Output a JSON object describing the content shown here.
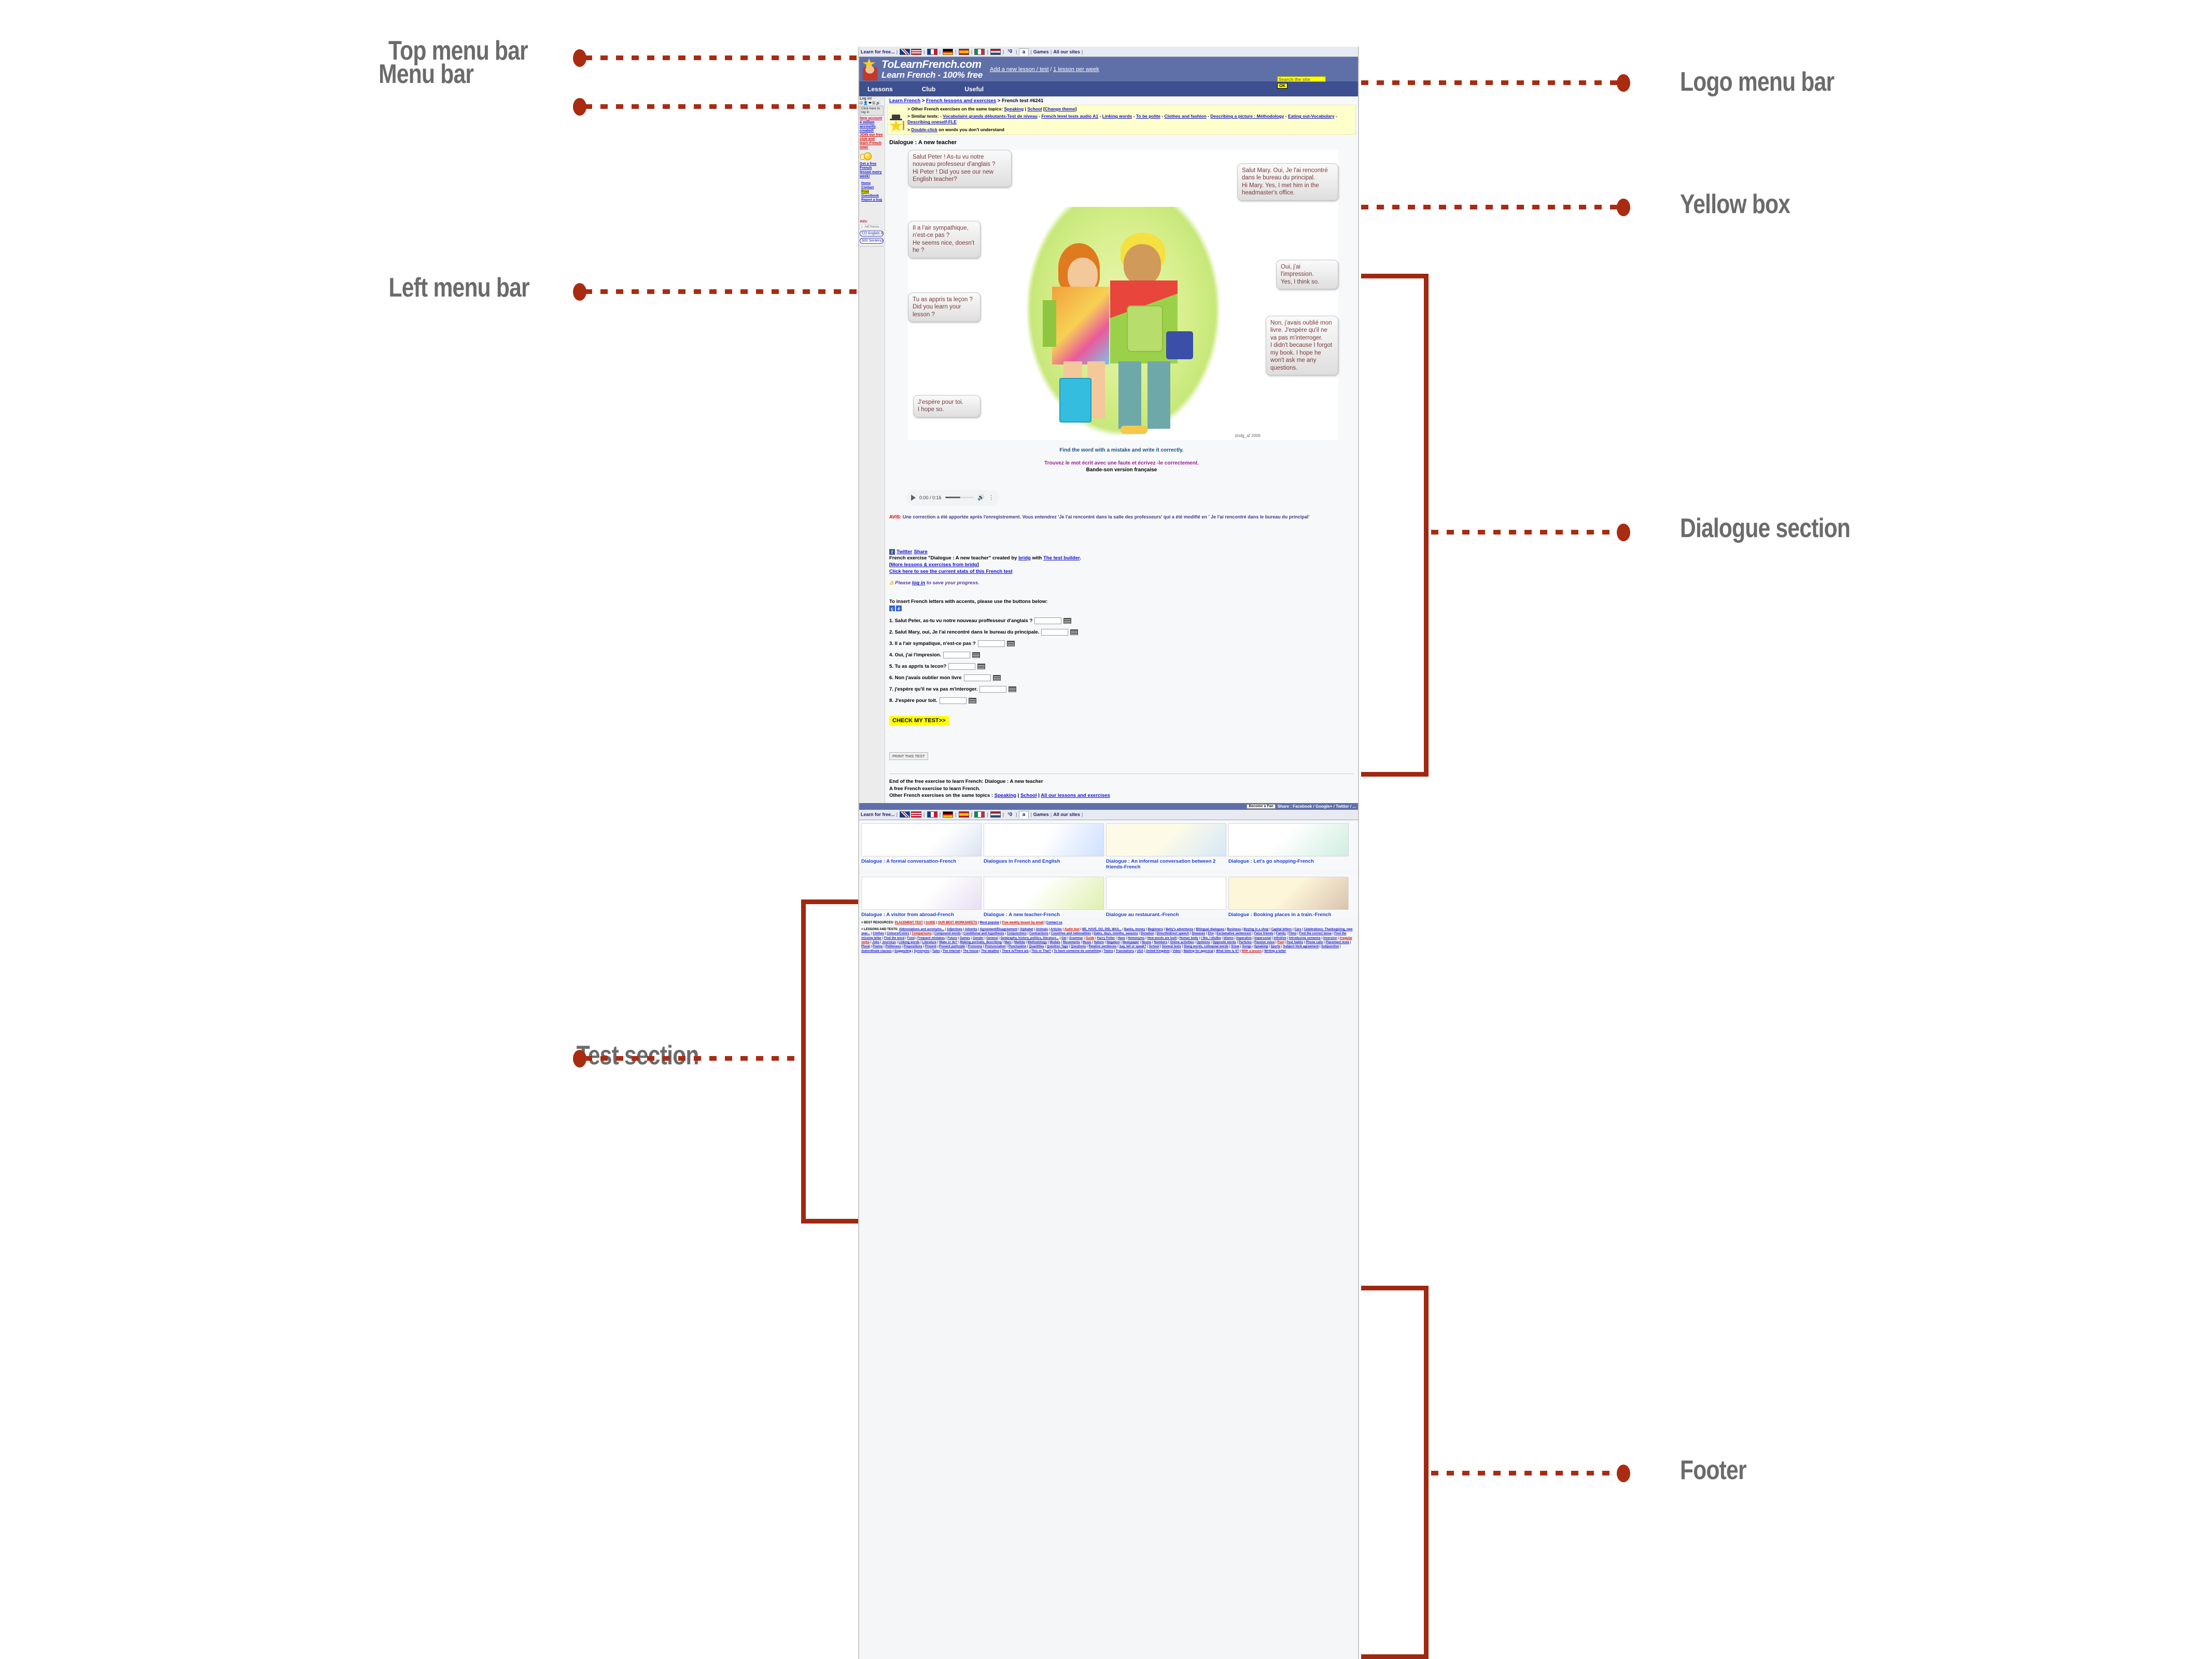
{
  "annotations": {
    "left": [
      {
        "label": "Top menu bar"
      },
      {
        "label": "Menu bar"
      },
      {
        "label": "Left menu bar"
      },
      {
        "label": "Test section"
      }
    ],
    "right": [
      {
        "label": "Logo menu bar"
      },
      {
        "label": "Yellow box"
      },
      {
        "label": "Dialogue section"
      },
      {
        "label": "Footer"
      }
    ],
    "accent_color": "#a02810",
    "label_color": "#6b6b6b"
  },
  "topbar": {
    "learn_for_free": "Learn for free...",
    "flags": [
      "uk-us-flag-icon",
      "france-flag-icon",
      "germany-flag-icon",
      "spain-flag-icon",
      "italy-flag-icon",
      "netherlands-flag-icon"
    ],
    "tab_io": "¹0",
    "tab_a": "a",
    "games": "Games",
    "all_our_sites": "All our sites"
  },
  "logobar": {
    "brand_line1": "ToLearnFrench.com",
    "brand_line2": "Learn French - 100% free",
    "link_add_lesson": "Add a new lesson / test",
    "separator": "/",
    "link_weekly": "1 lesson per week"
  },
  "navbar": {
    "items": [
      "Lessons",
      "Club",
      "Useful"
    ],
    "search_placeholder": "Search the site",
    "search_button": "OK"
  },
  "sidebar": {
    "login_title": "Log in!",
    "icons": [
      "checkbox-icon",
      "user-icon",
      "heart-icon",
      "list-icon",
      "speaker-icon",
      "note-icon",
      "close-icon"
    ],
    "click_here_btn": "Click here to log in",
    "links": [
      {
        "label": "New account",
        "color": "pink"
      },
      {
        "label": "4 million accounts created!",
        "color": "blue"
      },
      {
        "label": "JOIN our free club and learn French now!",
        "color": "red"
      }
    ],
    "promo": "Get a free French lesson every week!",
    "submenu": [
      "Home",
      "Contact",
      "Print",
      "Guestbook",
      "Report a bug"
    ],
    "submenu_highlight": "Print",
    "ads_label": "Ads:",
    "adchoices": "AdChoices",
    "ad_items": [
      "CD Anglais 4EME",
      "600 Sentences"
    ]
  },
  "breadcrumb": {
    "home": "Learn French",
    "sep": ">",
    "lessons": "French lessons and exercises",
    "current": "French test #6241"
  },
  "yellowbox": {
    "line1_prefix": "> Other French exercises on the same topics:",
    "topic1": "Speaking",
    "topic_sep": "|",
    "topic2": "School",
    "change_theme_open": "[",
    "change_theme": "Change theme",
    "change_theme_close": "]",
    "line2_prefix": "> Similar tests: -",
    "similar_tests": [
      "Vocabulaire grands débutants-Test de niveau",
      "French level tests audio A1",
      "Linking words",
      "To be polite",
      "Clothes and fashion",
      "Describing a picture : Méthodology",
      "Eating out-Vocabulary",
      "Describing oneself-FLE"
    ],
    "line3_prefix": ">",
    "doubleclick_link": "Double-click",
    "line3_suffix": "on words you don't understand"
  },
  "exercise": {
    "title": "Dialogue : A new teacher",
    "image_credit": "bridg_af 2006",
    "bubbles": [
      {
        "id": "b1",
        "fr": "Salut Peter !  As-tu vu notre nouveau professeur d'anglais ?",
        "en": "Hi Peter ! Did you see our new English teacher?"
      },
      {
        "id": "b2",
        "fr": "Salut Mary. Oui, Je l'ai rencontré dans le bureau du principal.",
        "en": "Hi Mary. Yes, I met him in the headmaster's office."
      },
      {
        "id": "b3",
        "fr": "Il a l'air sympathique, n'est-ce pas ?",
        "en": "He seems nice, doesn't he ?"
      },
      {
        "id": "b4",
        "fr": "Oui, j'ai l'impression.",
        "en": "Yes, I think so."
      },
      {
        "id": "b5",
        "fr": " Tu as appris ta leçon ?",
        "en": "Did you learn your lesson ?"
      },
      {
        "id": "b6",
        "fr": "Non, j'avais oublié mon livre. J'espère qu'il ne va pas m'interroger.",
        "en": "I didn't because I forgot my book. I hope he won't ask me any questions."
      },
      {
        "id": "b7",
        "fr": "J'espère pour toi.",
        "en": "I hope so."
      }
    ],
    "instruction_en": "Find the word with a mistake and write it correctly.",
    "instruction_fr": "Trouvez le mot écrit avec une faute et écrivez -le correctement.",
    "audio_label": "Bande-son version française",
    "player": {
      "time": "0:00 / 0:16",
      "play_icon": "play-icon",
      "volume_icon": "volume-icon",
      "menu_icon": "kebab-menu-icon"
    },
    "avis_label": "AVIS:",
    "avis_text": " Une correction a été apportée après l'enregistrement. Vous entendrez 'Je l'ai rencontré dans la salle des professeurs' qui a été modifié en ' Je l'ai rencontré dans le bureau du principal'"
  },
  "share": {
    "facebook_icon": "facebook-icon",
    "twitter": "Twitter",
    "share": "Share",
    "credit_pre": "French exercise \"Dialogue : A new teacher\" created by ",
    "author": "bridg",
    "credit_mid": " with ",
    "builder": "The test builder",
    "credit_post": ".",
    "more_open": "[",
    "more": "More lessons & exercises from bridg",
    "more_close": "]",
    "stats_link": "Click here to see the current stats of this French test",
    "login_pre": "Please ",
    "login_link": "log in",
    "login_post": " to save your progress."
  },
  "accents": {
    "label": "To insert French letters with accents, please use the buttons below:",
    "buttons": [
      "ç",
      "é"
    ]
  },
  "questions": [
    {
      "n": "1.",
      "text": "Salut Peter, as-tu vu notre nouveau proffesseur d'anglais ?",
      "value": ""
    },
    {
      "n": "2.",
      "text": "Salut Mary, oui, Je l'ai rencontré dans le bureau du principale.",
      "value": ""
    },
    {
      "n": "3.",
      "text": "Il a l'air sympatique, n'est-ce pas ?",
      "value": ""
    },
    {
      "n": "4.",
      "text": "Oui, j'ai l'impresion.",
      "value": ""
    },
    {
      "n": "5.",
      "text": "Tu as appris ta lecon?",
      "value": ""
    },
    {
      "n": "6.",
      "text": "Non j'avais oublier mon livre",
      "value": ""
    },
    {
      "n": "7.",
      "text": "j'espère qu'il ne va pas m'interoger.",
      "value": ""
    },
    {
      "n": "8.",
      "text": "J'espère pour toit.",
      "value": ""
    }
  ],
  "actions": {
    "check": "CHECK MY TEST>>",
    "print": "PRINT THIS TEST"
  },
  "end": {
    "line1": "End of the free exercise to learn French: Dialogue : A new teacher",
    "line2": "A free French exercise to learn French.",
    "line3_prefix": "Other French exercises on the same topics : ",
    "topic1": "Speaking",
    "sep": " | ",
    "topic2": "School",
    "topic3": "All our lessons and exercises"
  },
  "footer": {
    "become_fan": "Become a Fan",
    "share_text": "Share : Facebook / Google+ / Twitter / ...",
    "thumbs_row1": [
      {
        "caption": "Dialogue : A formal conversation-French"
      },
      {
        "caption": "Dialogues in French and English"
      },
      {
        "caption": "Dialogue : An informal conversation between 2 friends-French"
      },
      {
        "caption": "Dialogue : Let's go shopping-French"
      }
    ],
    "thumbs_row2": [
      {
        "caption": "Dialogue : A visitor from abroad-French"
      },
      {
        "caption": "Dialogue : A new teacher-French"
      },
      {
        "caption": "Dialogue au restaurant.-French"
      },
      {
        "caption": "Dialogue : Booking places in a train.-French"
      }
    ],
    "best_resources_label": "> BEST RESOURCES:",
    "best_resources": [
      {
        "label": "PLACEMENT TEST",
        "red": true
      },
      {
        "label": "GUIDE",
        "red": true
      },
      {
        "label": "OUR BEST WORKSHEETS",
        "red": true
      },
      {
        "label": "Most popular",
        "red": false
      },
      {
        "label": "Free weekly lesson by email",
        "red": true
      },
      {
        "label": "Contact us",
        "red": false
      }
    ],
    "lessons_label": "> LESSONS AND TESTS:",
    "lessons_links": [
      {
        "label": "Abbreviations and acronyms...",
        "red": false
      },
      {
        "label": "Adjectives",
        "red": false
      },
      {
        "label": "Adverbs",
        "red": false
      },
      {
        "label": "Agreement/Disagreement",
        "red": false
      },
      {
        "label": "Alphabet",
        "red": false
      },
      {
        "label": "Animals",
        "red": false
      },
      {
        "label": "Articles",
        "red": false
      },
      {
        "label": "Audio test",
        "red": true
      },
      {
        "label": "BE, HAVE, DO, DID, WAS...",
        "red": false
      },
      {
        "label": "Banks, money",
        "red": false
      },
      {
        "label": "Beginners",
        "red": false
      },
      {
        "label": "Betty's adventures",
        "red": false
      },
      {
        "label": "Bilingual dialogues",
        "red": false
      },
      {
        "label": "Business",
        "red": false
      },
      {
        "label": "Buying in a shop",
        "red": false
      },
      {
        "label": "Capital letters",
        "red": false
      },
      {
        "label": "Cars",
        "red": false
      },
      {
        "label": "Celebrations: Thanksgiving, new year...",
        "red": false
      },
      {
        "label": "Clothes",
        "red": false
      },
      {
        "label": "Colours/Colors",
        "red": false
      },
      {
        "label": "Comparisons",
        "red": true
      },
      {
        "label": "Compound words",
        "red": false
      },
      {
        "label": "Conditional and hypothesis",
        "red": false
      },
      {
        "label": "Conjunctions",
        "red": false
      },
      {
        "label": "Contractions",
        "red": false
      },
      {
        "label": "Countries and nationalities",
        "red": false
      },
      {
        "label": "Dates, days, months, seasons",
        "red": false
      },
      {
        "label": "Dictation",
        "red": false
      },
      {
        "label": "Direct/Indirect speech",
        "red": false
      },
      {
        "label": "Diseases",
        "red": false
      },
      {
        "label": "Etre",
        "red": false
      },
      {
        "label": "Exclamative sentences!",
        "red": false
      },
      {
        "label": "False friends",
        "red": false
      },
      {
        "label": "Family",
        "red": false
      },
      {
        "label": "Films",
        "red": false
      },
      {
        "label": "Find the correct tense",
        "red": false
      },
      {
        "label": "Find the missing letter",
        "red": false
      },
      {
        "label": "Find the word",
        "red": false
      },
      {
        "label": "Food",
        "red": false
      },
      {
        "label": "Frequent mistakes",
        "red": false
      },
      {
        "label": "Future",
        "red": false
      },
      {
        "label": "Games",
        "red": false
      },
      {
        "label": "Gender",
        "red": false
      },
      {
        "label": "General",
        "red": false
      },
      {
        "label": "Geography, history, politics, literature...",
        "red": false
      },
      {
        "label": "Get",
        "red": false
      },
      {
        "label": "Grammar",
        "red": false
      },
      {
        "label": "Guide",
        "red": true
      },
      {
        "label": "Harry Potter",
        "red": false
      },
      {
        "label": "Have",
        "red": false
      },
      {
        "label": "Homonyms",
        "red": false
      },
      {
        "label": "How words are built",
        "red": false
      },
      {
        "label": "Human body",
        "red": false
      },
      {
        "label": "I like, I dislike",
        "red": false
      },
      {
        "label": "Idioms",
        "red": false
      },
      {
        "label": "Imperative",
        "red": false
      },
      {
        "label": "Impersonal",
        "red": false
      },
      {
        "label": "Infinitive",
        "red": false
      },
      {
        "label": "Introducing someone",
        "red": false
      },
      {
        "label": "Inversion",
        "red": false
      },
      {
        "label": "Irregular verbs",
        "red": true
      },
      {
        "label": "Jobs",
        "red": false
      },
      {
        "label": "Journeys",
        "red": false
      },
      {
        "label": "Linking words",
        "red": false
      },
      {
        "label": "Literature",
        "red": false
      },
      {
        "label": "Make or do?",
        "red": false
      },
      {
        "label": "Making portraits, describing",
        "red": false
      },
      {
        "label": "Mars",
        "red": false
      },
      {
        "label": "Matilda",
        "red": false
      },
      {
        "label": "Methodology",
        "red": false
      },
      {
        "label": "Modals",
        "red": false
      },
      {
        "label": "Movements",
        "red": false
      },
      {
        "label": "Music",
        "red": false
      },
      {
        "label": "Nature",
        "red": false
      },
      {
        "label": "Negation",
        "red": false
      },
      {
        "label": "Newspaper",
        "red": false
      },
      {
        "label": "Nouns",
        "red": false
      },
      {
        "label": "Numbers",
        "red": false
      },
      {
        "label": "Online activities",
        "red": false
      },
      {
        "label": "Opinions",
        "red": false
      },
      {
        "label": "Opposite words",
        "red": false
      },
      {
        "label": "Particles",
        "red": false
      },
      {
        "label": "Passive voice",
        "red": false
      },
      {
        "label": "Past",
        "red": true
      },
      {
        "label": "Past habits",
        "red": false
      },
      {
        "label": "Phone calls",
        "red": false
      },
      {
        "label": "Placement tests",
        "red": false
      },
      {
        "label": "Plural",
        "red": false
      },
      {
        "label": "Poems",
        "red": false
      },
      {
        "label": "Politeness",
        "red": false
      },
      {
        "label": "Prepositions",
        "red": false
      },
      {
        "label": "Present",
        "red": false
      },
      {
        "label": "Present participle",
        "red": false
      },
      {
        "label": "Pronouns",
        "red": false
      },
      {
        "label": "Pronunciation",
        "red": false
      },
      {
        "label": "Punctuation",
        "red": false
      },
      {
        "label": "Quantities",
        "red": false
      },
      {
        "label": "Question Tags",
        "red": false
      },
      {
        "label": "Questions",
        "red": false
      },
      {
        "label": "Relative sentences",
        "red": false
      },
      {
        "label": "Say, tell or speak?",
        "red": false
      },
      {
        "label": "School",
        "red": false
      },
      {
        "label": "Several tests",
        "red": false
      },
      {
        "label": "Slang words, colloquial words",
        "red": false
      },
      {
        "label": "Snow",
        "red": false
      },
      {
        "label": "Songs",
        "red": false
      },
      {
        "label": "Speaking",
        "red": false
      },
      {
        "label": "Sports",
        "red": false
      },
      {
        "label": "Subject-Verb agreement",
        "red": false
      },
      {
        "label": "Subjunctive",
        "red": false
      },
      {
        "label": "Subordinate clauses",
        "red": false
      },
      {
        "label": "Suggesting",
        "red": false
      },
      {
        "label": "Synonyms",
        "red": false
      },
      {
        "label": "Tales",
        "red": false
      },
      {
        "label": "The Internet",
        "red": false
      },
      {
        "label": "The house",
        "red": false
      },
      {
        "label": "The weather",
        "red": false
      },
      {
        "label": "There is/There are",
        "red": false
      },
      {
        "label": "This or That?",
        "red": false
      },
      {
        "label": "To have someone do something",
        "red": false
      },
      {
        "label": "Towns",
        "red": false
      },
      {
        "label": "Translations",
        "red": false
      },
      {
        "label": "USA",
        "red": false
      },
      {
        "label": "United Kingdom",
        "red": false
      },
      {
        "label": "Video",
        "red": false
      },
      {
        "label": "Waiting for approval",
        "red": false
      },
      {
        "label": "What time is it?",
        "red": false
      },
      {
        "label": "With a lesson",
        "red": true
      },
      {
        "label": "Writing a letter",
        "red": false
      }
    ]
  }
}
